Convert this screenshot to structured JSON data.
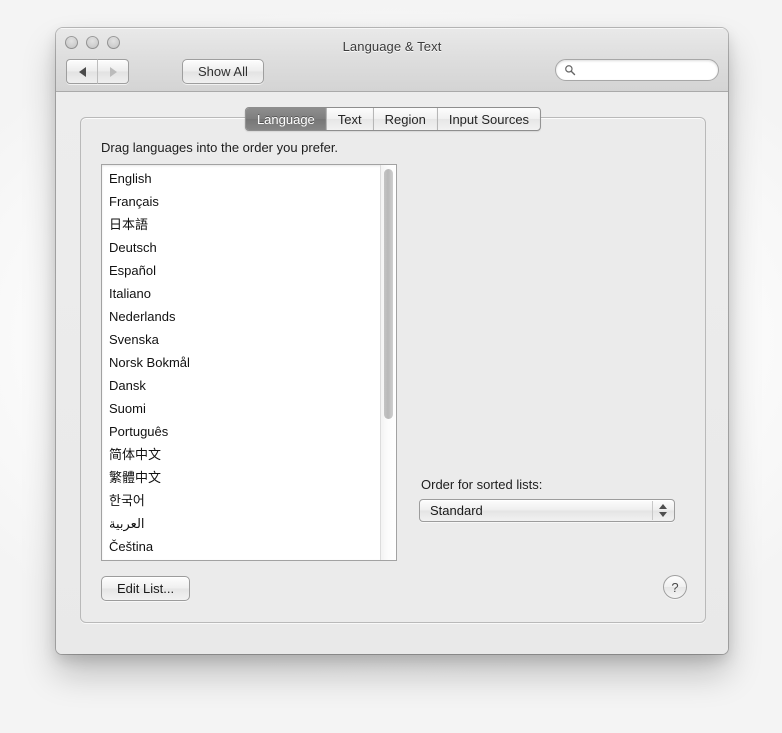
{
  "window": {
    "title": "Language & Text",
    "traffic_lights": [
      "close",
      "minimize",
      "zoom"
    ]
  },
  "toolbar": {
    "back_icon": "back-arrow-icon",
    "forward_icon": "forward-arrow-icon",
    "show_all_label": "Show All",
    "search": {
      "icon": "search-icon",
      "value": "",
      "placeholder": ""
    }
  },
  "tabs": [
    {
      "label": "Language",
      "active": true
    },
    {
      "label": "Text",
      "active": false
    },
    {
      "label": "Region",
      "active": false
    },
    {
      "label": "Input Sources",
      "active": false
    }
  ],
  "panel": {
    "hint": "Drag languages into the order you prefer.",
    "languages": [
      "English",
      "Français",
      "日本語",
      "Deutsch",
      "Español",
      "Italiano",
      "Nederlands",
      "Svenska",
      "Norsk Bokmål",
      "Dansk",
      "Suomi",
      "Português",
      "简体中文",
      "繁體中文",
      "한국어",
      "العربية",
      "Čeština"
    ],
    "sort_label": "Order for sorted lists:",
    "sort_value": "Standard",
    "sort_options": [
      "Standard"
    ],
    "edit_list_label": "Edit List...",
    "help_label": "?"
  },
  "colors": {
    "window_chrome": "#ececec",
    "panel_bg": "#ebebeb",
    "active_tab": "#7e7e7e",
    "list_bg": "#ffffff",
    "text": "#1d1d1d"
  }
}
